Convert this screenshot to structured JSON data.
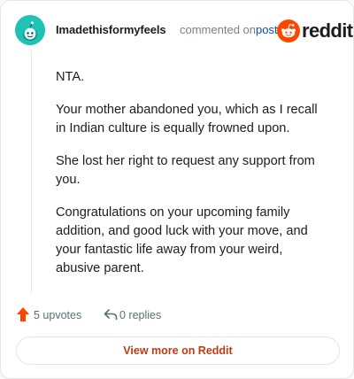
{
  "header": {
    "username": "Imadethisformyfeels",
    "action_text": "commented on",
    "post_link": "post",
    "logo_text": "reddit"
  },
  "comment": {
    "paragraphs": [
      "NTA.",
      "Your mother abandoned you, which as I recall in Indian culture is equally frowned upon.",
      "She lost her right to request any support from you.",
      "Congratulations on your upcoming family addition, and good luck with your move, and your fantastic life away from your weird, abusive parent."
    ]
  },
  "actions": {
    "upvotes": "5 upvotes",
    "replies": "0 replies"
  },
  "footer": {
    "view_button": "View more on Reddit"
  },
  "colors": {
    "avatar": "#1fc2b3",
    "reddit_orange": "#ff4500",
    "upvote": "#ff4500",
    "link": "#0a4ea8",
    "button_text": "#c23a13"
  },
  "icons": [
    "snoo-avatar-icon",
    "reddit-logo-icon",
    "upvote-arrow-icon",
    "reply-arrow-icon"
  ]
}
